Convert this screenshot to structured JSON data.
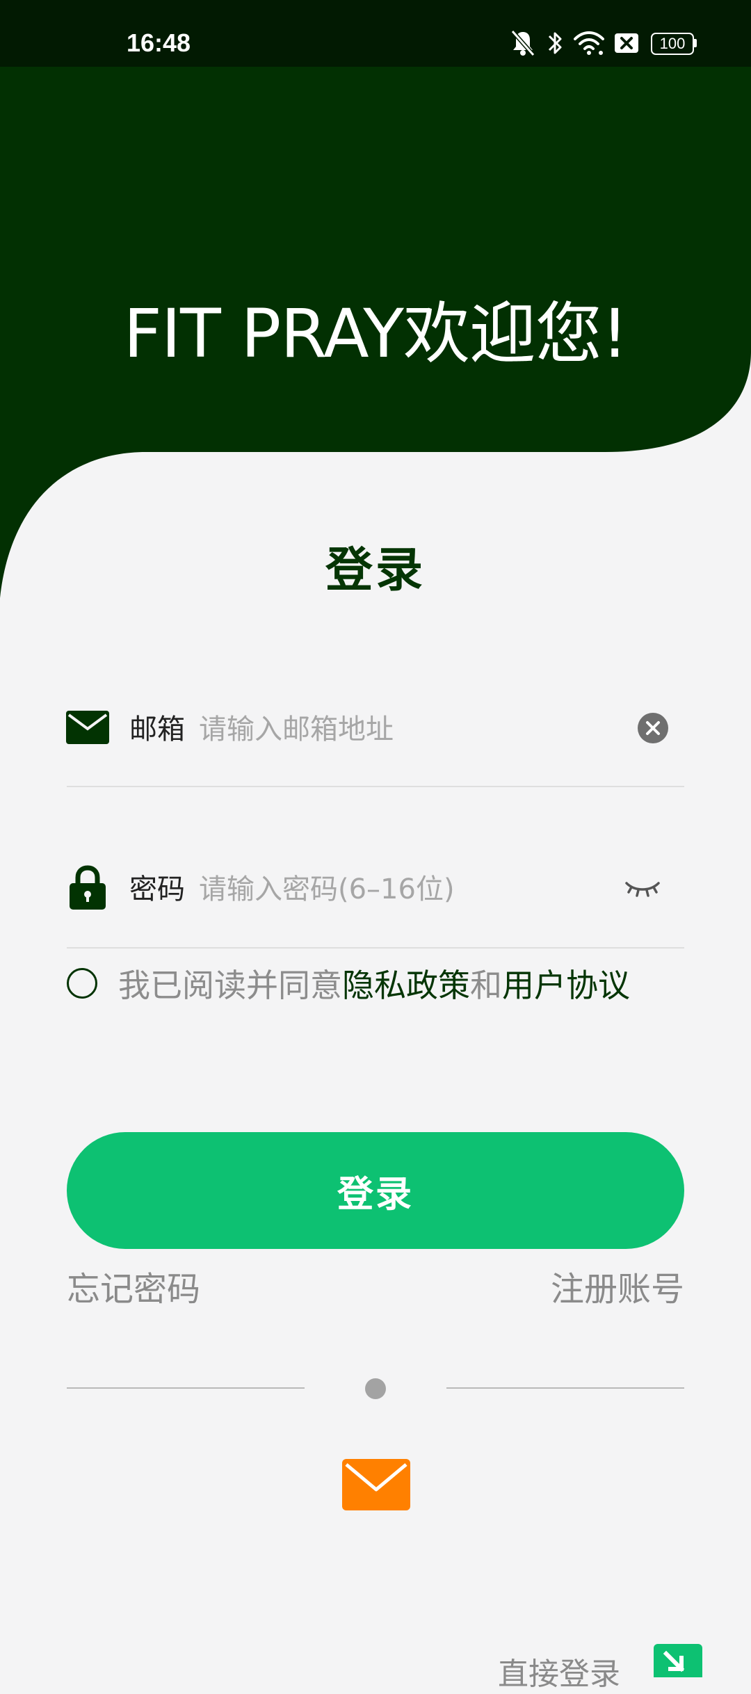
{
  "status_bar": {
    "time": "16:48",
    "battery": "100",
    "icons": [
      "bell-off-icon",
      "bluetooth-icon",
      "wifi-icon",
      "close-box-icon",
      "battery-icon"
    ]
  },
  "header": {
    "welcome": "FIT PRAY欢迎您!"
  },
  "login": {
    "title": "登录",
    "email": {
      "label": "邮箱",
      "value": "",
      "placeholder": "请输入邮箱地址",
      "icon": "mail-icon",
      "clear_icon": "clear-icon"
    },
    "password": {
      "label": "密码",
      "value": "",
      "placeholder": "请输入密码(6–16位)",
      "icon": "lock-icon",
      "toggle_icon": "eye-closed-icon"
    },
    "agreement": {
      "prefix": "我已阅读并同意",
      "privacy": "隐私政策",
      "and": "和",
      "terms": "用户协议",
      "checked": false
    },
    "button_label": "登录",
    "forgot": "忘记密码",
    "register": "注册账号",
    "alt_method_icon": "email-login-icon",
    "direct_login": "直接登录"
  },
  "colors": {
    "header_green": "#023002",
    "title_green": "#053505",
    "button_green": "#0dc172",
    "alt_orange": "#ff8000"
  }
}
